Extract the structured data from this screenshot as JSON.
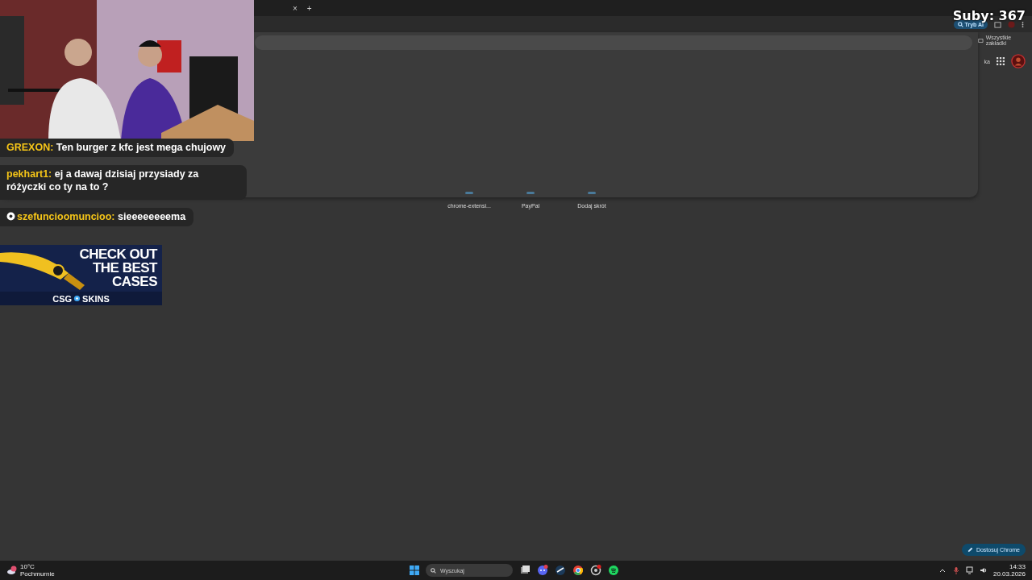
{
  "browser": {
    "new_tab": "+",
    "tab_close": "×",
    "ai_mode_button": "Tryb AI",
    "all_bookmarks": "Wszystkie zakładki",
    "cut_label": "ka",
    "shortcuts": [
      {
        "label": "chrome-extensi..."
      },
      {
        "label": "PayPal"
      },
      {
        "label": "Dodaj skrót"
      }
    ],
    "customize_button": "Dostosuj Chrome"
  },
  "stream_overlay": {
    "subscriber_count": "Suby: 367",
    "chat": [
      {
        "user": "GREXON:",
        "message": "Ten burger z kfc jest mega chujowy",
        "badge": false
      },
      {
        "user": "pekhart1:",
        "message": "ej a dawaj dzisiaj przysiady za różyczki co ty na to ?",
        "badge": false
      },
      {
        "user": "szefuncioomuncioo:",
        "message": "sieeeeeeeema",
        "badge": true
      }
    ],
    "ad": {
      "headline": [
        "CHECK OUT",
        "THE BEST",
        "CASES"
      ],
      "brand_left": "CSG",
      "brand_right": "SKINS"
    }
  },
  "taskbar": {
    "temperature": "10°C",
    "condition": "Pochmurnie",
    "search_placeholder": "Wyszukaj",
    "time": "14:33",
    "date": "20.03.2026"
  }
}
